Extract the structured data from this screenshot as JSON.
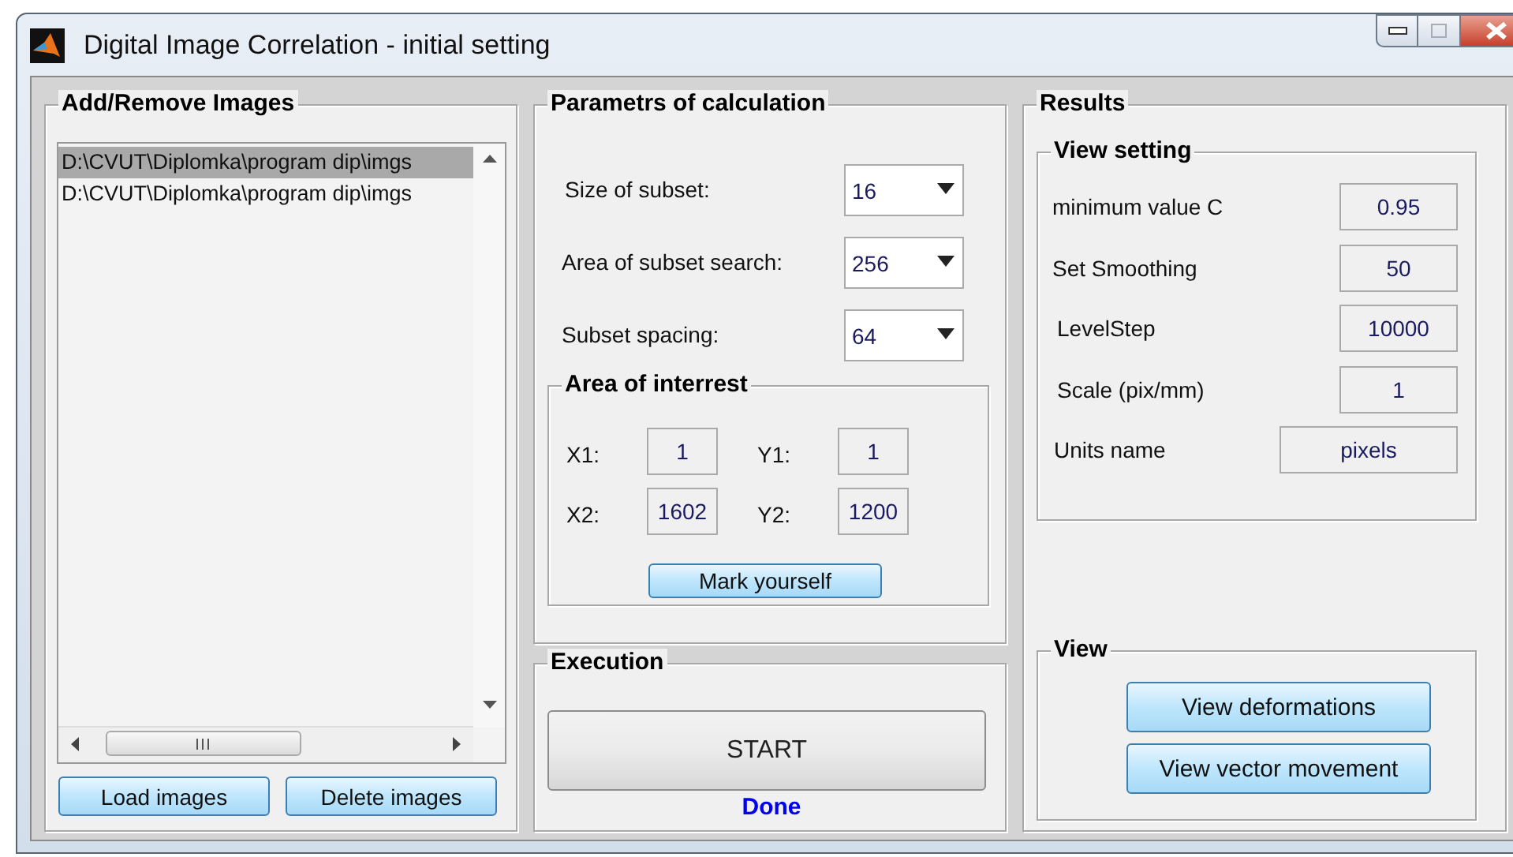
{
  "window": {
    "title": "Digital Image Correlation - initial setting"
  },
  "images_panel": {
    "title": "Add/Remove Images",
    "files": [
      {
        "text": "D:\\CVUT\\Diplomka\\program dip\\imgs",
        "selected": true
      },
      {
        "text": "D:\\CVUT\\Diplomka\\program dip\\imgs",
        "selected": false
      }
    ],
    "buttons": [
      "Load images",
      "Delete images"
    ]
  },
  "parameters": {
    "title": "Parametrs of calculation",
    "dropdowns": [
      {
        "label": "Size of subset:",
        "value": "16"
      },
      {
        "label": "Area of subset search:",
        "value": "256"
      },
      {
        "label": "Subset spacing:",
        "value": "64"
      }
    ],
    "area": {
      "title": "Area of interrest",
      "fields": [
        {
          "label": "X1:",
          "value": "1"
        },
        {
          "label": "Y1:",
          "value": "1"
        },
        {
          "label": "X2:",
          "value": "1602"
        },
        {
          "label": "Y2:",
          "value": "1200"
        }
      ],
      "button": "Mark yourself"
    }
  },
  "execution": {
    "title": "Execution",
    "button": "START",
    "status": "Done"
  },
  "results": {
    "title": "Results",
    "view_setting": {
      "title": "View setting",
      "fields": [
        {
          "label": "minimum value C",
          "value": "0.95",
          "kind": "short"
        },
        {
          "label": "Set Smoothing",
          "value": "50",
          "kind": "short"
        },
        {
          "label": "LevelStep",
          "value": "10000",
          "kind": "short"
        },
        {
          "label": "Scale (pix/mm)",
          "value": "1",
          "kind": "short"
        },
        {
          "label": "Units name",
          "value": "pixels",
          "kind": "wide"
        }
      ]
    },
    "view": {
      "title": "View",
      "buttons": [
        "View deformations",
        "View vector movement"
      ]
    }
  }
}
